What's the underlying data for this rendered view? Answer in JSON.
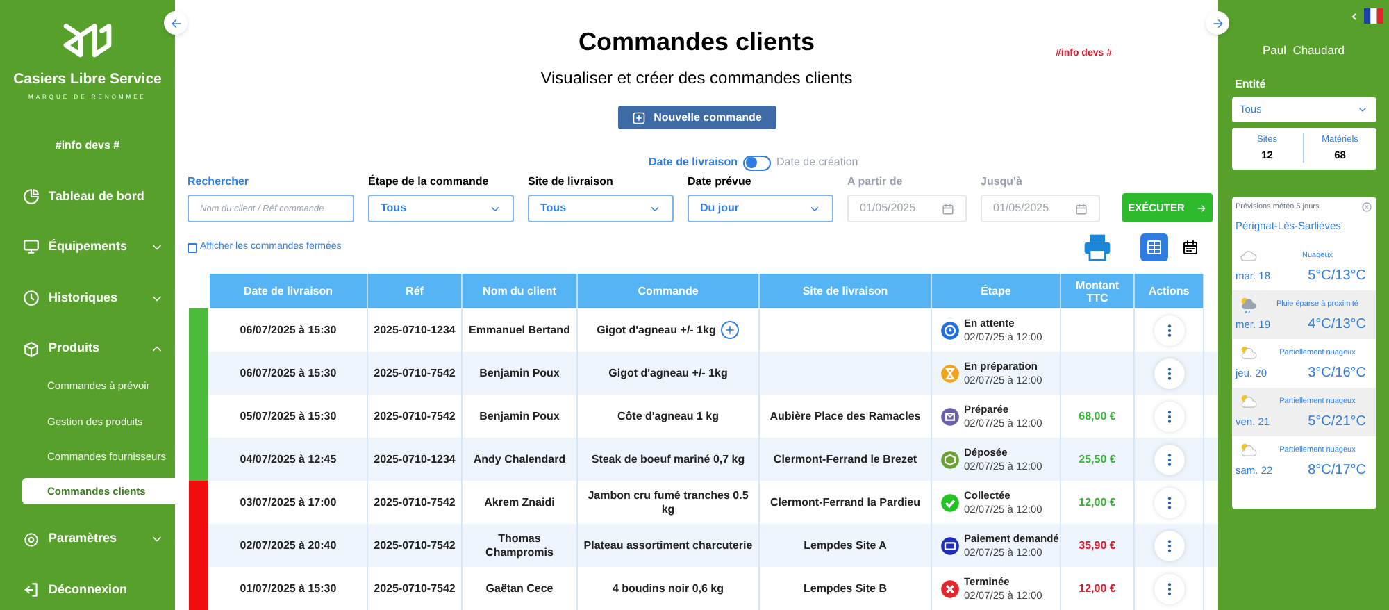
{
  "sidebar": {
    "brand": "Casiers Libre Service",
    "tagline": "MARQUE DE RENOMMEE",
    "info": "#info devs #",
    "items": [
      {
        "label": "Tableau de bord",
        "kind": "dashboard"
      },
      {
        "label": "Équipements",
        "kind": "monitor",
        "expanded": false
      },
      {
        "label": "Historiques",
        "kind": "clock",
        "expanded": false
      },
      {
        "label": "Produits",
        "kind": "box",
        "expanded": true,
        "children": [
          {
            "label": "Commandes à prévoir",
            "selected": false
          },
          {
            "label": "Gestion des produits",
            "selected": false
          },
          {
            "label": "Commandes fournisseurs",
            "selected": false
          },
          {
            "label": "Commandes clients",
            "selected": true
          }
        ]
      },
      {
        "label": "Paramètres",
        "kind": "gear",
        "expanded": false
      },
      {
        "label": "Déconnexion",
        "kind": "logout"
      }
    ]
  },
  "header": {
    "title": "Commandes clients",
    "subtitle": "Visualiser et créer des commandes clients",
    "dev_note": "#info devs #",
    "new_button": "Nouvelle commande"
  },
  "filters": {
    "date_toggle": {
      "left": "Date de livraison",
      "right": "Date de création",
      "on": false
    },
    "search": {
      "label": "Rechercher",
      "placeholder": "Nom du client / Réf commande"
    },
    "selects": [
      {
        "label": "Étape de la commande",
        "value": "Tous"
      },
      {
        "label": "Site de livraison",
        "value": "Tous"
      },
      {
        "label": "Date prévue",
        "value": "Du jour"
      }
    ],
    "dates": [
      {
        "label": "A partir de",
        "value": "01/05/2025"
      },
      {
        "label": "Jusqu'à",
        "value": "01/05/2025"
      }
    ],
    "execute": "EXÉCUTER",
    "show_closed": {
      "label": "Afficher les commandes fermées",
      "checked": false
    },
    "views": [
      {
        "kind": "table",
        "selected": true
      },
      {
        "kind": "calendar",
        "selected": false
      }
    ]
  },
  "table": {
    "columns": [
      "Date de livraison",
      "Réf",
      "Nom du client",
      "Commande",
      "Site de livraison",
      "Étape",
      "Montant TTC",
      "Actions"
    ],
    "rows": [
      {
        "color": "#4cbb3c",
        "date": "06/07/2025 à 15:30",
        "ref": "2025-0710-1234",
        "client": "Emmanuel Bertand",
        "order": "Gigot d'agneau +/- 1kg",
        "add": true,
        "step": {
          "kind": "waiting",
          "label": "En attente",
          "time": "02/07/25 à 12:00"
        }
      },
      {
        "color": "#4cbb3c",
        "date": "06/07/2025 à 15:30",
        "ref": "2025-0710-7542",
        "client": "Benjamin Poux",
        "order": "Gigot d'agneau +/- 1kg",
        "add": false,
        "step": {
          "kind": "preparing",
          "label": "En préparation",
          "time": "02/07/25 à 12:00"
        }
      },
      {
        "color": "#4cbb3c",
        "date": "05/07/2025 à 15:30",
        "ref": "2025-0710-7542",
        "client": "Benjamin Poux",
        "order": "Côte d'agneau 1 kg",
        "add": false,
        "site": "Aubière Place des Ramacles",
        "step": {
          "kind": "prepared",
          "label": "Préparée",
          "time": "02/07/25 à 12:00"
        },
        "amount": "68,00 €",
        "paid": true
      },
      {
        "color": "#4cbb3c",
        "date": "04/07/2025 à 12:45",
        "ref": "2025-0710-1234",
        "client": "Andy Chalendard",
        "order": "Steak de boeuf mariné 0,7 kg",
        "add": false,
        "site": "Clermont-Ferrand le Brezet",
        "step": {
          "kind": "deposited",
          "label": "Déposée",
          "time": "02/07/25 à 12:00"
        },
        "amount": "25,50 €",
        "paid": true
      },
      {
        "color": "#f20d0d",
        "date": "03/07/2025 à 17:00",
        "ref": "2025-0710-7542",
        "client": "Akrem Znaidi",
        "order": "Jambon cru fumé tranches 0.5 kg",
        "add": false,
        "site": "Clermont-Ferrand la Pardieu",
        "step": {
          "kind": "collected",
          "label": "Collectée",
          "time": "02/07/25 à 12:00"
        },
        "amount": "12,00 €",
        "paid": true
      },
      {
        "color": "#f20d0d",
        "date": "02/07/2025 à 20:40",
        "ref": "2025-0710-7542",
        "client": "Thomas Champromis",
        "order": "Plateau assortiment charcuterie",
        "add": false,
        "site": "Lempdes Site A",
        "step": {
          "kind": "payment",
          "label": "Paiement demandé",
          "time": "02/07/25 à 12:00"
        },
        "amount": "35,90 €",
        "paid": false
      },
      {
        "color": "#f20d0d",
        "date": "01/07/2025 à 15:30",
        "ref": "2025-0710-7542",
        "client": "Gaëtan Cece",
        "order": "4 boudins noir 0,6 kg",
        "add": false,
        "site": "Lempdes Site B",
        "step": {
          "kind": "done",
          "label": "Terminée",
          "time": "02/07/25 à 12:00"
        },
        "amount": "12,00 €",
        "paid": false
      }
    ]
  },
  "right_panel": {
    "user": "Paul  Chaudard",
    "entity_label": "Entité",
    "entity_value": "Tous",
    "stats": [
      {
        "label": "Sites",
        "value": "12"
      },
      {
        "label": "Matériels",
        "value": "68"
      }
    ],
    "weather": {
      "title": "Prévisions météo 5 jours",
      "city": "Pérignat-Lès-Sarliéves",
      "days": [
        {
          "kind": "cloud",
          "desc": "Nuageux",
          "day": "mar. 18",
          "temp": "5°C/13°C"
        },
        {
          "kind": "rain",
          "desc": "Pluie éparse à proximité",
          "day": "mer. 19",
          "temp": "4°C/13°C"
        },
        {
          "kind": "partly",
          "desc": "Partiellement nuageux",
          "day": "jeu. 20",
          "temp": "3°C/16°C"
        },
        {
          "kind": "partly",
          "desc": "Partiellement nuageux",
          "day": "ven. 21",
          "temp": "5°C/21°C"
        },
        {
          "kind": "partly",
          "desc": "Partiellement nuageux",
          "day": "sam. 22",
          "temp": "8°C/17°C"
        }
      ]
    }
  }
}
